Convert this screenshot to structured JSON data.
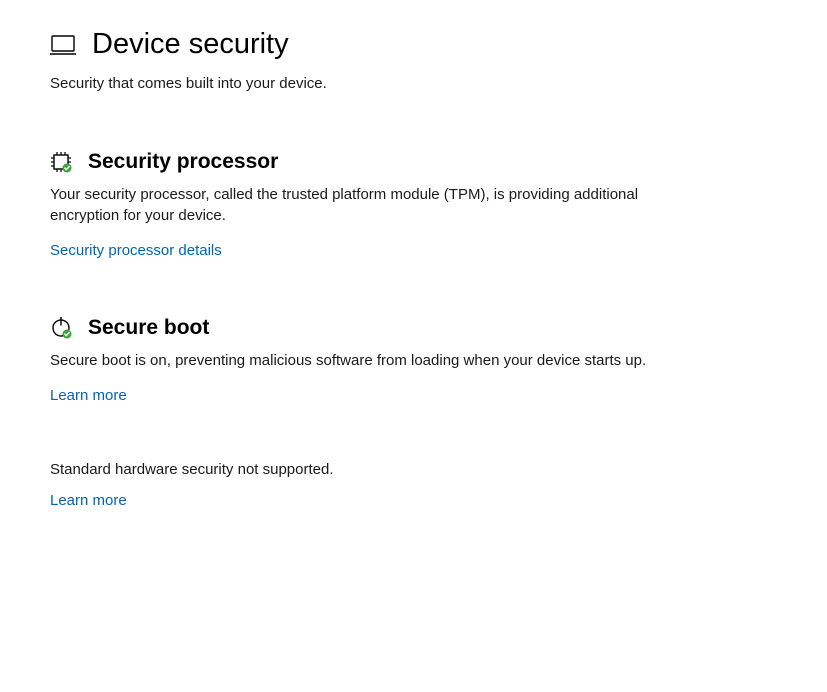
{
  "header": {
    "title": "Device security",
    "subtitle": "Security that comes built into your device."
  },
  "sections": {
    "securityProcessor": {
      "title": "Security processor",
      "description": "Your security processor, called the trusted platform module (TPM), is providing additional encryption for your device.",
      "linkLabel": "Security processor details"
    },
    "secureBoot": {
      "title": "Secure boot",
      "description": "Secure boot is on, preventing malicious software from loading when your device starts up.",
      "linkLabel": "Learn more"
    }
  },
  "status": {
    "text": "Standard hardware security not supported.",
    "linkLabel": "Learn more"
  }
}
